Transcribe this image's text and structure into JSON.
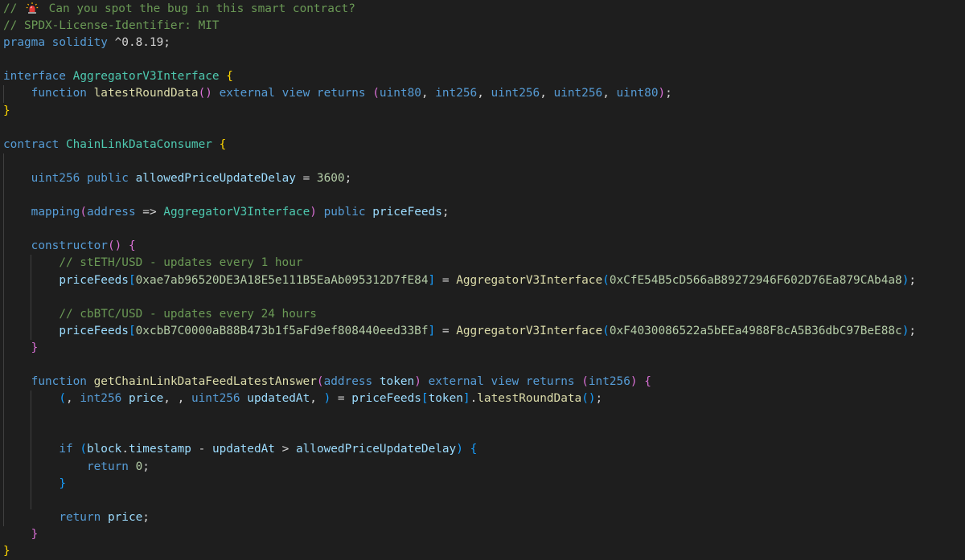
{
  "editor": {
    "lines": [
      [
        {
          "t": "// ",
          "c": "c-comment"
        },
        {
          "icon": "siren-icon"
        },
        {
          "t": " Can you spot the bug in this smart contract?",
          "c": "c-comment"
        }
      ],
      [
        {
          "t": "// SPDX-License-Identifier: MIT",
          "c": "c-comment"
        }
      ],
      [
        {
          "t": "pragma",
          "c": "c-kw"
        },
        {
          "t": " ",
          "c": "c-plain"
        },
        {
          "t": "solidity",
          "c": "c-kw"
        },
        {
          "t": " ^0.8.19;",
          "c": "c-plain"
        }
      ],
      [],
      [
        {
          "t": "interface",
          "c": "c-kw"
        },
        {
          "t": " ",
          "c": "c-plain"
        },
        {
          "t": "AggregatorV3Interface",
          "c": "c-type"
        },
        {
          "t": " ",
          "c": "c-plain"
        },
        {
          "t": "{",
          "c": "c-brace1"
        }
      ],
      [
        {
          "t": "    ",
          "c": "c-plain"
        },
        {
          "t": "function",
          "c": "c-kw"
        },
        {
          "t": " ",
          "c": "c-plain"
        },
        {
          "t": "latestRoundData",
          "c": "c-fn"
        },
        {
          "t": "()",
          "c": "c-brace2"
        },
        {
          "t": " ",
          "c": "c-plain"
        },
        {
          "t": "external",
          "c": "c-kw"
        },
        {
          "t": " ",
          "c": "c-plain"
        },
        {
          "t": "view",
          "c": "c-kw"
        },
        {
          "t": " ",
          "c": "c-plain"
        },
        {
          "t": "returns",
          "c": "c-kw"
        },
        {
          "t": " ",
          "c": "c-plain"
        },
        {
          "t": "(",
          "c": "c-brace2"
        },
        {
          "t": "uint80",
          "c": "c-kw"
        },
        {
          "t": ", ",
          "c": "c-plain"
        },
        {
          "t": "int256",
          "c": "c-kw"
        },
        {
          "t": ", ",
          "c": "c-plain"
        },
        {
          "t": "uint256",
          "c": "c-kw"
        },
        {
          "t": ", ",
          "c": "c-plain"
        },
        {
          "t": "uint256",
          "c": "c-kw"
        },
        {
          "t": ", ",
          "c": "c-plain"
        },
        {
          "t": "uint80",
          "c": "c-kw"
        },
        {
          "t": ")",
          "c": "c-brace2"
        },
        {
          "t": ";",
          "c": "c-plain"
        }
      ],
      [
        {
          "t": "}",
          "c": "c-brace1"
        }
      ],
      [],
      [
        {
          "t": "contract",
          "c": "c-kw"
        },
        {
          "t": " ",
          "c": "c-plain"
        },
        {
          "t": "ChainLinkDataConsumer",
          "c": "c-type"
        },
        {
          "t": " ",
          "c": "c-plain"
        },
        {
          "t": "{",
          "c": "c-brace1"
        }
      ],
      [],
      [
        {
          "t": "    ",
          "c": "c-plain"
        },
        {
          "t": "uint256",
          "c": "c-kw"
        },
        {
          "t": " ",
          "c": "c-plain"
        },
        {
          "t": "public",
          "c": "c-kw"
        },
        {
          "t": " ",
          "c": "c-plain"
        },
        {
          "t": "allowedPriceUpdateDelay",
          "c": "c-var"
        },
        {
          "t": " = ",
          "c": "c-op"
        },
        {
          "t": "3600",
          "c": "c-num"
        },
        {
          "t": ";",
          "c": "c-plain"
        }
      ],
      [],
      [
        {
          "t": "    ",
          "c": "c-plain"
        },
        {
          "t": "mapping",
          "c": "c-kw"
        },
        {
          "t": "(",
          "c": "c-brace2"
        },
        {
          "t": "address",
          "c": "c-kw"
        },
        {
          "t": " => ",
          "c": "c-op"
        },
        {
          "t": "AggregatorV3Interface",
          "c": "c-type"
        },
        {
          "t": ")",
          "c": "c-brace2"
        },
        {
          "t": " ",
          "c": "c-plain"
        },
        {
          "t": "public",
          "c": "c-kw"
        },
        {
          "t": " ",
          "c": "c-plain"
        },
        {
          "t": "priceFeeds",
          "c": "c-var"
        },
        {
          "t": ";",
          "c": "c-plain"
        }
      ],
      [],
      [
        {
          "t": "    ",
          "c": "c-plain"
        },
        {
          "t": "constructor",
          "c": "c-kw"
        },
        {
          "t": "()",
          "c": "c-brace2"
        },
        {
          "t": " ",
          "c": "c-plain"
        },
        {
          "t": "{",
          "c": "c-brace2"
        }
      ],
      [
        {
          "t": "        ",
          "c": "c-plain"
        },
        {
          "t": "// stETH/USD - updates every 1 hour",
          "c": "c-comment"
        }
      ],
      [
        {
          "t": "        ",
          "c": "c-plain"
        },
        {
          "t": "priceFeeds",
          "c": "c-var"
        },
        {
          "t": "[",
          "c": "c-brace3"
        },
        {
          "t": "0xae7ab96520DE3A18E5e111B5EaAb095312D7fE84",
          "c": "c-num"
        },
        {
          "t": "]",
          "c": "c-brace3"
        },
        {
          "t": " = ",
          "c": "c-op"
        },
        {
          "t": "AggregatorV3Interface",
          "c": "c-fn"
        },
        {
          "t": "(",
          "c": "c-brace3"
        },
        {
          "t": "0xCfE54B5cD566aB89272946F602D76Ea879CAb4a8",
          "c": "c-num"
        },
        {
          "t": ")",
          "c": "c-brace3"
        },
        {
          "t": ";",
          "c": "c-plain"
        }
      ],
      [],
      [
        {
          "t": "        ",
          "c": "c-plain"
        },
        {
          "t": "// cbBTC/USD - updates every 24 hours",
          "c": "c-comment"
        }
      ],
      [
        {
          "t": "        ",
          "c": "c-plain"
        },
        {
          "t": "priceFeeds",
          "c": "c-var"
        },
        {
          "t": "[",
          "c": "c-brace3"
        },
        {
          "t": "0xcbB7C0000aB88B473b1f5aFd9ef808440eed33Bf",
          "c": "c-num"
        },
        {
          "t": "]",
          "c": "c-brace3"
        },
        {
          "t": " = ",
          "c": "c-op"
        },
        {
          "t": "AggregatorV3Interface",
          "c": "c-fn"
        },
        {
          "t": "(",
          "c": "c-brace3"
        },
        {
          "t": "0xF4030086522a5bEEa4988F8cA5B36dbC97BeE88c",
          "c": "c-num"
        },
        {
          "t": ")",
          "c": "c-brace3"
        },
        {
          "t": ";",
          "c": "c-plain"
        }
      ],
      [
        {
          "t": "    ",
          "c": "c-plain"
        },
        {
          "t": "}",
          "c": "c-brace2"
        }
      ],
      [],
      [
        {
          "t": "    ",
          "c": "c-plain"
        },
        {
          "t": "function",
          "c": "c-kw"
        },
        {
          "t": " ",
          "c": "c-plain"
        },
        {
          "t": "getChainLinkDataFeedLatestAnswer",
          "c": "c-fn"
        },
        {
          "t": "(",
          "c": "c-brace2"
        },
        {
          "t": "address",
          "c": "c-kw"
        },
        {
          "t": " ",
          "c": "c-plain"
        },
        {
          "t": "token",
          "c": "c-var"
        },
        {
          "t": ")",
          "c": "c-brace2"
        },
        {
          "t": " ",
          "c": "c-plain"
        },
        {
          "t": "external",
          "c": "c-kw"
        },
        {
          "t": " ",
          "c": "c-plain"
        },
        {
          "t": "view",
          "c": "c-kw"
        },
        {
          "t": " ",
          "c": "c-plain"
        },
        {
          "t": "returns",
          "c": "c-kw"
        },
        {
          "t": " ",
          "c": "c-plain"
        },
        {
          "t": "(",
          "c": "c-brace2"
        },
        {
          "t": "int256",
          "c": "c-kw"
        },
        {
          "t": ")",
          "c": "c-brace2"
        },
        {
          "t": " ",
          "c": "c-plain"
        },
        {
          "t": "{",
          "c": "c-brace2"
        }
      ],
      [
        {
          "t": "        ",
          "c": "c-plain"
        },
        {
          "t": "(",
          "c": "c-brace3"
        },
        {
          "t": ", ",
          "c": "c-plain"
        },
        {
          "t": "int256",
          "c": "c-kw"
        },
        {
          "t": " ",
          "c": "c-plain"
        },
        {
          "t": "price",
          "c": "c-var"
        },
        {
          "t": ", , ",
          "c": "c-plain"
        },
        {
          "t": "uint256",
          "c": "c-kw"
        },
        {
          "t": " ",
          "c": "c-plain"
        },
        {
          "t": "updatedAt",
          "c": "c-var"
        },
        {
          "t": ", ",
          "c": "c-plain"
        },
        {
          "t": ")",
          "c": "c-brace3"
        },
        {
          "t": " = ",
          "c": "c-op"
        },
        {
          "t": "priceFeeds",
          "c": "c-var"
        },
        {
          "t": "[",
          "c": "c-brace3"
        },
        {
          "t": "token",
          "c": "c-var"
        },
        {
          "t": "]",
          "c": "c-brace3"
        },
        {
          "t": ".",
          "c": "c-plain"
        },
        {
          "t": "latestRoundData",
          "c": "c-fn"
        },
        {
          "t": "()",
          "c": "c-brace3"
        },
        {
          "t": ";",
          "c": "c-plain"
        }
      ],
      [],
      [],
      [
        {
          "t": "        ",
          "c": "c-plain"
        },
        {
          "t": "if",
          "c": "c-kw"
        },
        {
          "t": " ",
          "c": "c-plain"
        },
        {
          "t": "(",
          "c": "c-brace3"
        },
        {
          "t": "block",
          "c": "c-var"
        },
        {
          "t": ".",
          "c": "c-plain"
        },
        {
          "t": "timestamp",
          "c": "c-var"
        },
        {
          "t": " - ",
          "c": "c-op"
        },
        {
          "t": "updatedAt",
          "c": "c-var"
        },
        {
          "t": " > ",
          "c": "c-op"
        },
        {
          "t": "allowedPriceUpdateDelay",
          "c": "c-var"
        },
        {
          "t": ")",
          "c": "c-brace3"
        },
        {
          "t": " ",
          "c": "c-plain"
        },
        {
          "t": "{",
          "c": "c-brace3"
        }
      ],
      [
        {
          "t": "            ",
          "c": "c-plain"
        },
        {
          "t": "return",
          "c": "c-kw"
        },
        {
          "t": " ",
          "c": "c-plain"
        },
        {
          "t": "0",
          "c": "c-num"
        },
        {
          "t": ";",
          "c": "c-plain"
        }
      ],
      [
        {
          "t": "        ",
          "c": "c-plain"
        },
        {
          "t": "}",
          "c": "c-brace3"
        }
      ],
      [],
      [
        {
          "t": "        ",
          "c": "c-plain"
        },
        {
          "t": "return",
          "c": "c-kw"
        },
        {
          "t": " ",
          "c": "c-plain"
        },
        {
          "t": "price",
          "c": "c-var"
        },
        {
          "t": ";",
          "c": "c-plain"
        }
      ],
      [
        {
          "t": "    ",
          "c": "c-plain"
        },
        {
          "t": "}",
          "c": "c-brace2"
        }
      ],
      [
        {
          "t": "}",
          "c": "c-brace1"
        }
      ]
    ]
  }
}
